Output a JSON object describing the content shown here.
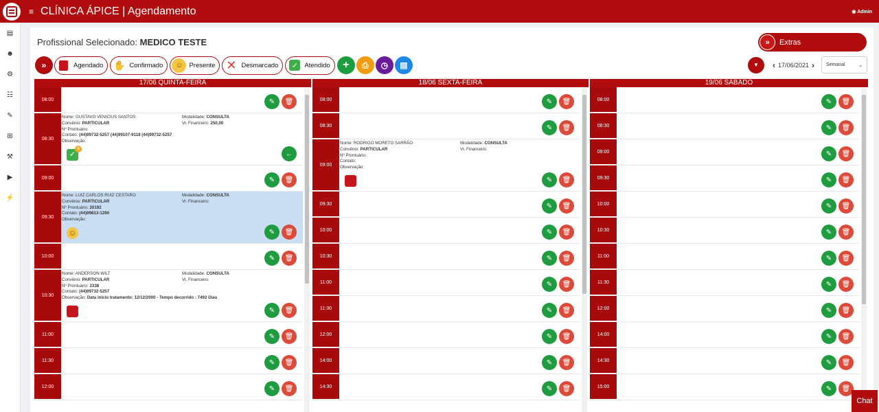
{
  "app": {
    "title": "CLÍNICA ÁPICE | Agendamento",
    "user": "Admin"
  },
  "header": {
    "prof_label": "Profissional Selecionado:",
    "prof_name": "MEDICO TESTE",
    "extras": "Extras"
  },
  "legend": {
    "agendado": "Agendado",
    "confirmado": "Confirmado",
    "presente": "Presente",
    "desmarcado": "Desmarcado",
    "atendido": "Atendido"
  },
  "nav": {
    "date": "17/06/2021",
    "view": "Semanal"
  },
  "colors": {
    "brand": "#b00c0e",
    "edit": "#1f9c3f",
    "delete": "#dc4a3a",
    "highlight": "#c9def2"
  },
  "columns": [
    {
      "title": "17/06 QUINTA-FEIRA",
      "rows": [
        {
          "time": "08:00"
        },
        {
          "time": "08:30",
          "appt": {
            "nome": "Nome: GUSTAVO VENICIUS SANTOS",
            "convenio_label": "Convênio:",
            "convenio": "PARTICULAR",
            "prontuario_label": "Nº Prontuário:",
            "prontuario": "",
            "contato_label": "Contato:",
            "contato": "(44)99732-5257 (44)99107-9118 (44)99732-5257",
            "obs_label": "Observação:",
            "obs": "",
            "modalidade_label": "Modalidade:",
            "modalidade": "CONSULTA",
            "financeiro_label": "Vr. Financeiro:",
            "financeiro": "250,00"
          }
        },
        {
          "time": "09:00"
        },
        {
          "time": "09:30",
          "appt": {
            "nome": "Nome: LUIZ CARLOS RUIZ CESTARO",
            "convenio_label": "Convênio:",
            "convenio": "PARTICULAR",
            "prontuario_label": "Nº Prontuário:",
            "prontuario": "20192",
            "contato_label": "Contato:",
            "contato": "(44)99813-1290",
            "obs_label": "Observação:",
            "obs": "",
            "modalidade_label": "Modalidade:",
            "modalidade": "CONSULTA",
            "financeiro_label": "Vr. Financeiro:",
            "financeiro": ""
          }
        },
        {
          "time": "10:00"
        },
        {
          "time": "10:30",
          "appt": {
            "nome": "Nome: ANDERSON WILT",
            "convenio_label": "Convênio:",
            "convenio": "PARTICULAR",
            "prontuario_label": "Nº Prontuário:",
            "prontuario": "2338",
            "contato_label": "Contato:",
            "contato": "(44)99732-5257",
            "obs_label": "Observação:",
            "obs": "Data inicio tratamento: 12/12/2000 - Tempo decorrido : 7492 Dias",
            "modalidade_label": "Modalidade:",
            "modalidade": "CONSULTA",
            "financeiro_label": "Vr. Financeiro:",
            "financeiro": ""
          }
        },
        {
          "time": "11:00"
        },
        {
          "time": "11:30"
        },
        {
          "time": "12:00"
        }
      ]
    },
    {
      "title": "18/06 SEXTA-FEIRA",
      "rows": [
        {
          "time": "08:00"
        },
        {
          "time": "08:30"
        },
        {
          "time": "09:00",
          "appt": {
            "nome": "Nome: RODRIGO MORETO SARRÃO",
            "convenio_label": "Convênio:",
            "convenio": "PARTICULAR",
            "prontuario_label": "Nº Prontuário:",
            "prontuario": "",
            "contato_label": "Contato:",
            "contato": "",
            "obs_label": "Observação:",
            "obs": "",
            "modalidade_label": "Modalidade:",
            "modalidade": "CONSULTA",
            "financeiro_label": "Vr. Financeiro:",
            "financeiro": ""
          }
        },
        {
          "time": "09:30"
        },
        {
          "time": "10:00"
        },
        {
          "time": "10:30"
        },
        {
          "time": "11:00"
        },
        {
          "time": "11:30"
        },
        {
          "time": "12:00"
        },
        {
          "time": "14:00"
        },
        {
          "time": "14:30"
        }
      ]
    },
    {
      "title": "19/06 SÁBADO",
      "rows": [
        {
          "time": "08:00"
        },
        {
          "time": "08:30"
        },
        {
          "time": "09:00"
        },
        {
          "time": "09:30"
        },
        {
          "time": "10:00"
        },
        {
          "time": "10:30"
        },
        {
          "time": "11:00"
        },
        {
          "time": "11:30"
        },
        {
          "time": "12:00"
        },
        {
          "time": "14:00"
        },
        {
          "time": "14:30"
        },
        {
          "time": "15:00"
        }
      ]
    }
  ],
  "chat": "Chat"
}
